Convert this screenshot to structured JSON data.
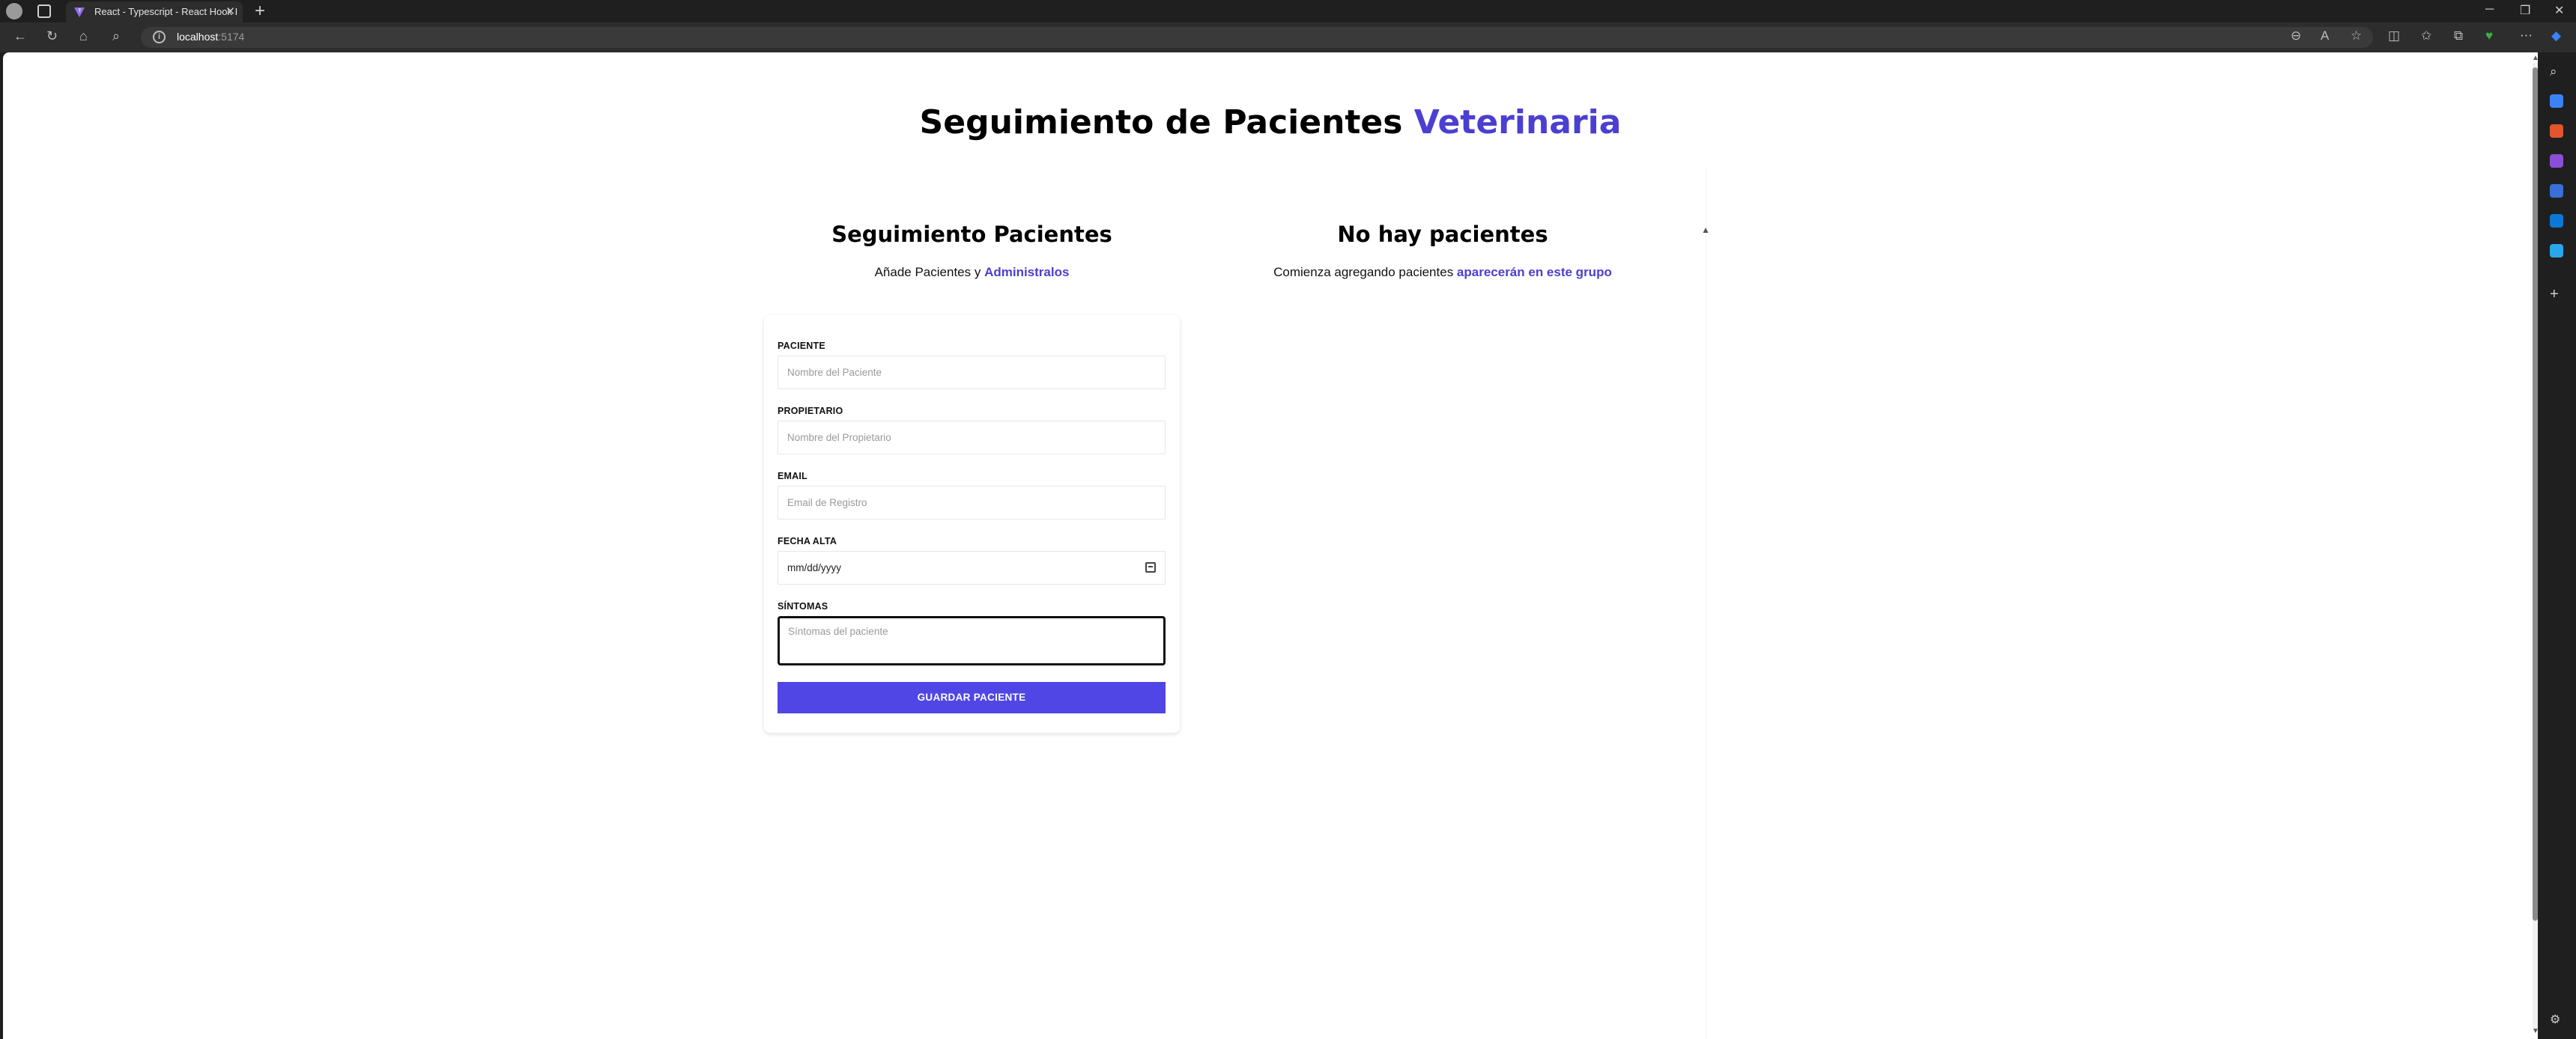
{
  "browser": {
    "tab_title": "React - Typescript - React Hook I",
    "tab_close": "✕",
    "new_tab": "+",
    "url_host": "localhost",
    "url_port": ":5174"
  },
  "page": {
    "title_main": "Seguimiento de Pacientes ",
    "title_accent": "Veterinaria",
    "left_heading": "Seguimiento Pacientes",
    "left_sub_prefix": "Añade Pacientes y ",
    "left_sub_link": "Administralos",
    "right_heading": "No hay pacientes",
    "right_sub_prefix": "Comienza agregando pacientes ",
    "right_sub_link": "aparecerán en este grupo"
  },
  "form": {
    "patient_label": "PACIENTE",
    "patient_placeholder": "Nombre del Paciente",
    "owner_label": "PROPIETARIO",
    "owner_placeholder": "Nombre del Propietario",
    "email_label": "EMAIL",
    "email_placeholder": "Email de Registro",
    "date_label": "FECHA ALTA",
    "date_value": "mm/dd/yyyy",
    "symptoms_label": "SÍNTOMAS",
    "symptoms_placeholder": "Síntomas del paciente",
    "submit_label": "GUARDAR PACIENTE"
  },
  "icons": {
    "back": "back-icon",
    "reload": "reload-icon",
    "home": "home-icon",
    "search": "search-icon",
    "calendar": "calendar-icon"
  },
  "colors": {
    "accent": "#4b3fd1",
    "button": "#4f46e5"
  }
}
